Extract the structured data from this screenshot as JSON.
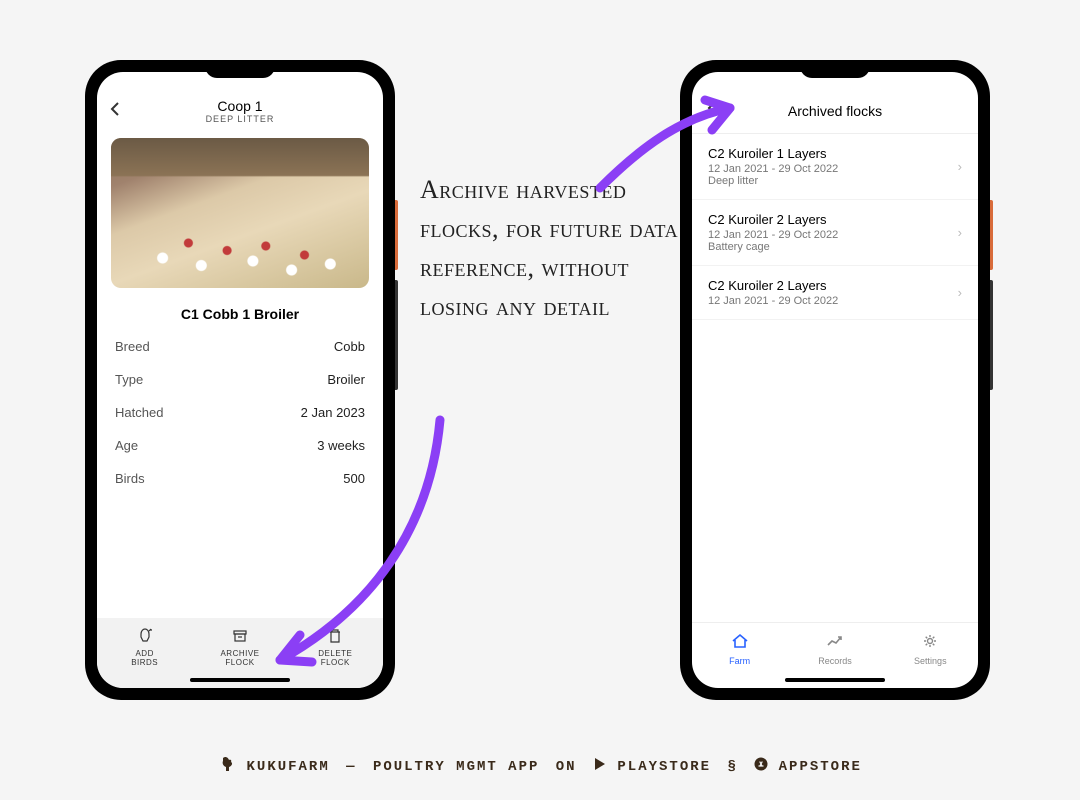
{
  "annotation": "Archive harvested flocks, for future data reference, without losing any detail",
  "left_phone": {
    "header": {
      "title": "Coop 1",
      "subtitle": "DEEP LITTER"
    },
    "coop_name": "C1 Cobb 1 Broiler",
    "details": [
      {
        "label": "Breed",
        "value": "Cobb"
      },
      {
        "label": "Type",
        "value": "Broiler"
      },
      {
        "label": "Hatched",
        "value": "2 Jan 2023"
      },
      {
        "label": "Age",
        "value": "3 weeks"
      },
      {
        "label": "Birds",
        "value": "500"
      }
    ],
    "actions": [
      {
        "label": "ADD\nBIRDS",
        "icon": "rocket"
      },
      {
        "label": "ARCHIVE\nFLOCK",
        "icon": "archive"
      },
      {
        "label": "DELETE\nFLOCK",
        "icon": "trash"
      }
    ]
  },
  "right_phone": {
    "header_title": "Archived flocks",
    "items": [
      {
        "name": "C2 Kuroiler 1 Layers",
        "dates": "12 Jan 2021 - 29 Oct 2022",
        "type": "Deep litter"
      },
      {
        "name": "C2 Kuroiler 2 Layers",
        "dates": "12 Jan 2021 - 29 Oct 2022",
        "type": "Battery cage"
      },
      {
        "name": "C2 Kuroiler 2 Layers",
        "dates": "12 Jan 2021 - 29 Oct 2022",
        "type": ""
      }
    ],
    "nav": [
      {
        "label": "Farm",
        "active": true
      },
      {
        "label": "Records",
        "active": false
      },
      {
        "label": "Settings",
        "active": false
      }
    ]
  },
  "footer": {
    "brand": "KUKUFARM",
    "tagline": "POULTRY MGMT APP",
    "on": "ON",
    "playstore": "PLAYSTORE",
    "amp": "§",
    "appstore": "APPSTORE"
  }
}
